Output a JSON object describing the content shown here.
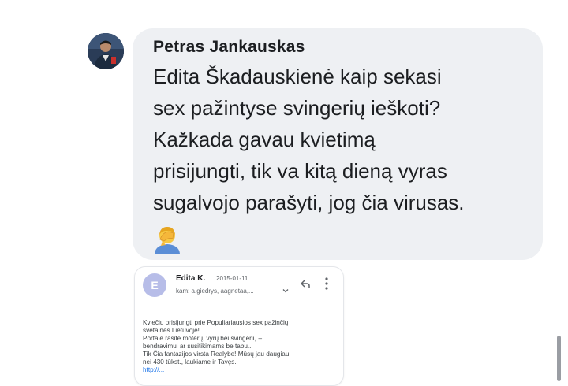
{
  "post": {
    "sender_name": "Petras Jankauskas",
    "message_lines": [
      "Edita Škadauskienė kaip sekasi",
      "sex pažintyse svingerių ieškoti?",
      "Kažkada gavau kvietimą",
      "prisijungti, tik va kitą dieną vyras",
      "sugalvojo parašyti, jog čia virusas."
    ],
    "emoji": "person-facepalming-icon"
  },
  "email": {
    "avatar_letter": "E",
    "sender": "Edita K.",
    "date": "2015-01-11",
    "recipients": "kam: a.giedrys, aagnetaa,...",
    "body_lines": [
      "Kviečiu prisijungti prie Populiariausios sex pažinčių",
      "svetainės Lietuvoje!",
      "Portale rasite moterų, vyrų bei svingerių –",
      "bendravimui ar susitikimams be tabu...",
      "Tik Čia fantazijos virsta Realybe! Mūsų jau daugiau",
      "nei 430 tūkst., laukiame ir Tavęs."
    ],
    "link_text": "http://...",
    "icons": [
      "reply-icon",
      "more-vertical-icon",
      "chevron-down-icon"
    ]
  },
  "colors": {
    "bubble_background": "#eef0f3",
    "text": "#1c1e21",
    "email_avatar": "#b7bde8",
    "link": "#1a73e8"
  }
}
